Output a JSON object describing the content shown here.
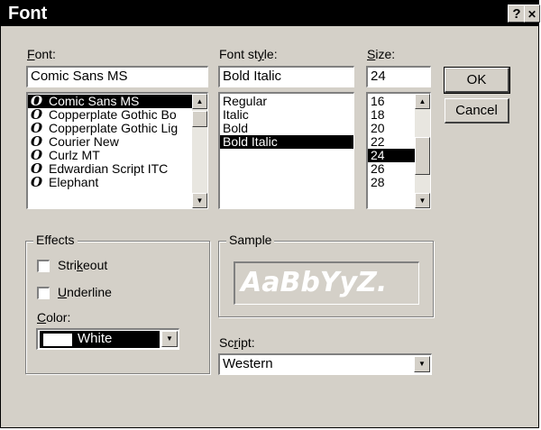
{
  "window": {
    "title": "Font",
    "help_label": "?",
    "close_label": "✕"
  },
  "font": {
    "label": "Font:",
    "value": "Comic Sans MS",
    "items": [
      {
        "label": "Comic Sans MS",
        "selected": true
      },
      {
        "label": "Copperplate Gothic Bo",
        "selected": false
      },
      {
        "label": "Copperplate Gothic Lig",
        "selected": false
      },
      {
        "label": "Courier New",
        "selected": false
      },
      {
        "label": "Curlz MT",
        "selected": false
      },
      {
        "label": "Edwardian Script ITC",
        "selected": false
      },
      {
        "label": "Elephant",
        "selected": false
      }
    ],
    "item_icon": "opentype-font-icon"
  },
  "style": {
    "label": "Font style:",
    "value": "Bold Italic",
    "items": [
      {
        "label": "Regular",
        "selected": false
      },
      {
        "label": "Italic",
        "selected": false
      },
      {
        "label": "Bold",
        "selected": false
      },
      {
        "label": "Bold Italic",
        "selected": true
      }
    ]
  },
  "size": {
    "label": "Size:",
    "value": "24",
    "items": [
      {
        "label": "16",
        "selected": false
      },
      {
        "label": "18",
        "selected": false
      },
      {
        "label": "20",
        "selected": false
      },
      {
        "label": "22",
        "selected": false
      },
      {
        "label": "24",
        "selected": true
      },
      {
        "label": "26",
        "selected": false
      },
      {
        "label": "28",
        "selected": false
      }
    ]
  },
  "buttons": {
    "ok": "OK",
    "cancel": "Cancel"
  },
  "effects": {
    "title": "Effects",
    "strikeout": "Strikeout",
    "underline": "Underline",
    "color_label": "Color:",
    "color_value": "White",
    "color_swatch": "#ffffff"
  },
  "sample": {
    "title": "Sample",
    "text": "AaBbYyZ."
  },
  "script": {
    "label": "Script:",
    "value": "Western"
  }
}
